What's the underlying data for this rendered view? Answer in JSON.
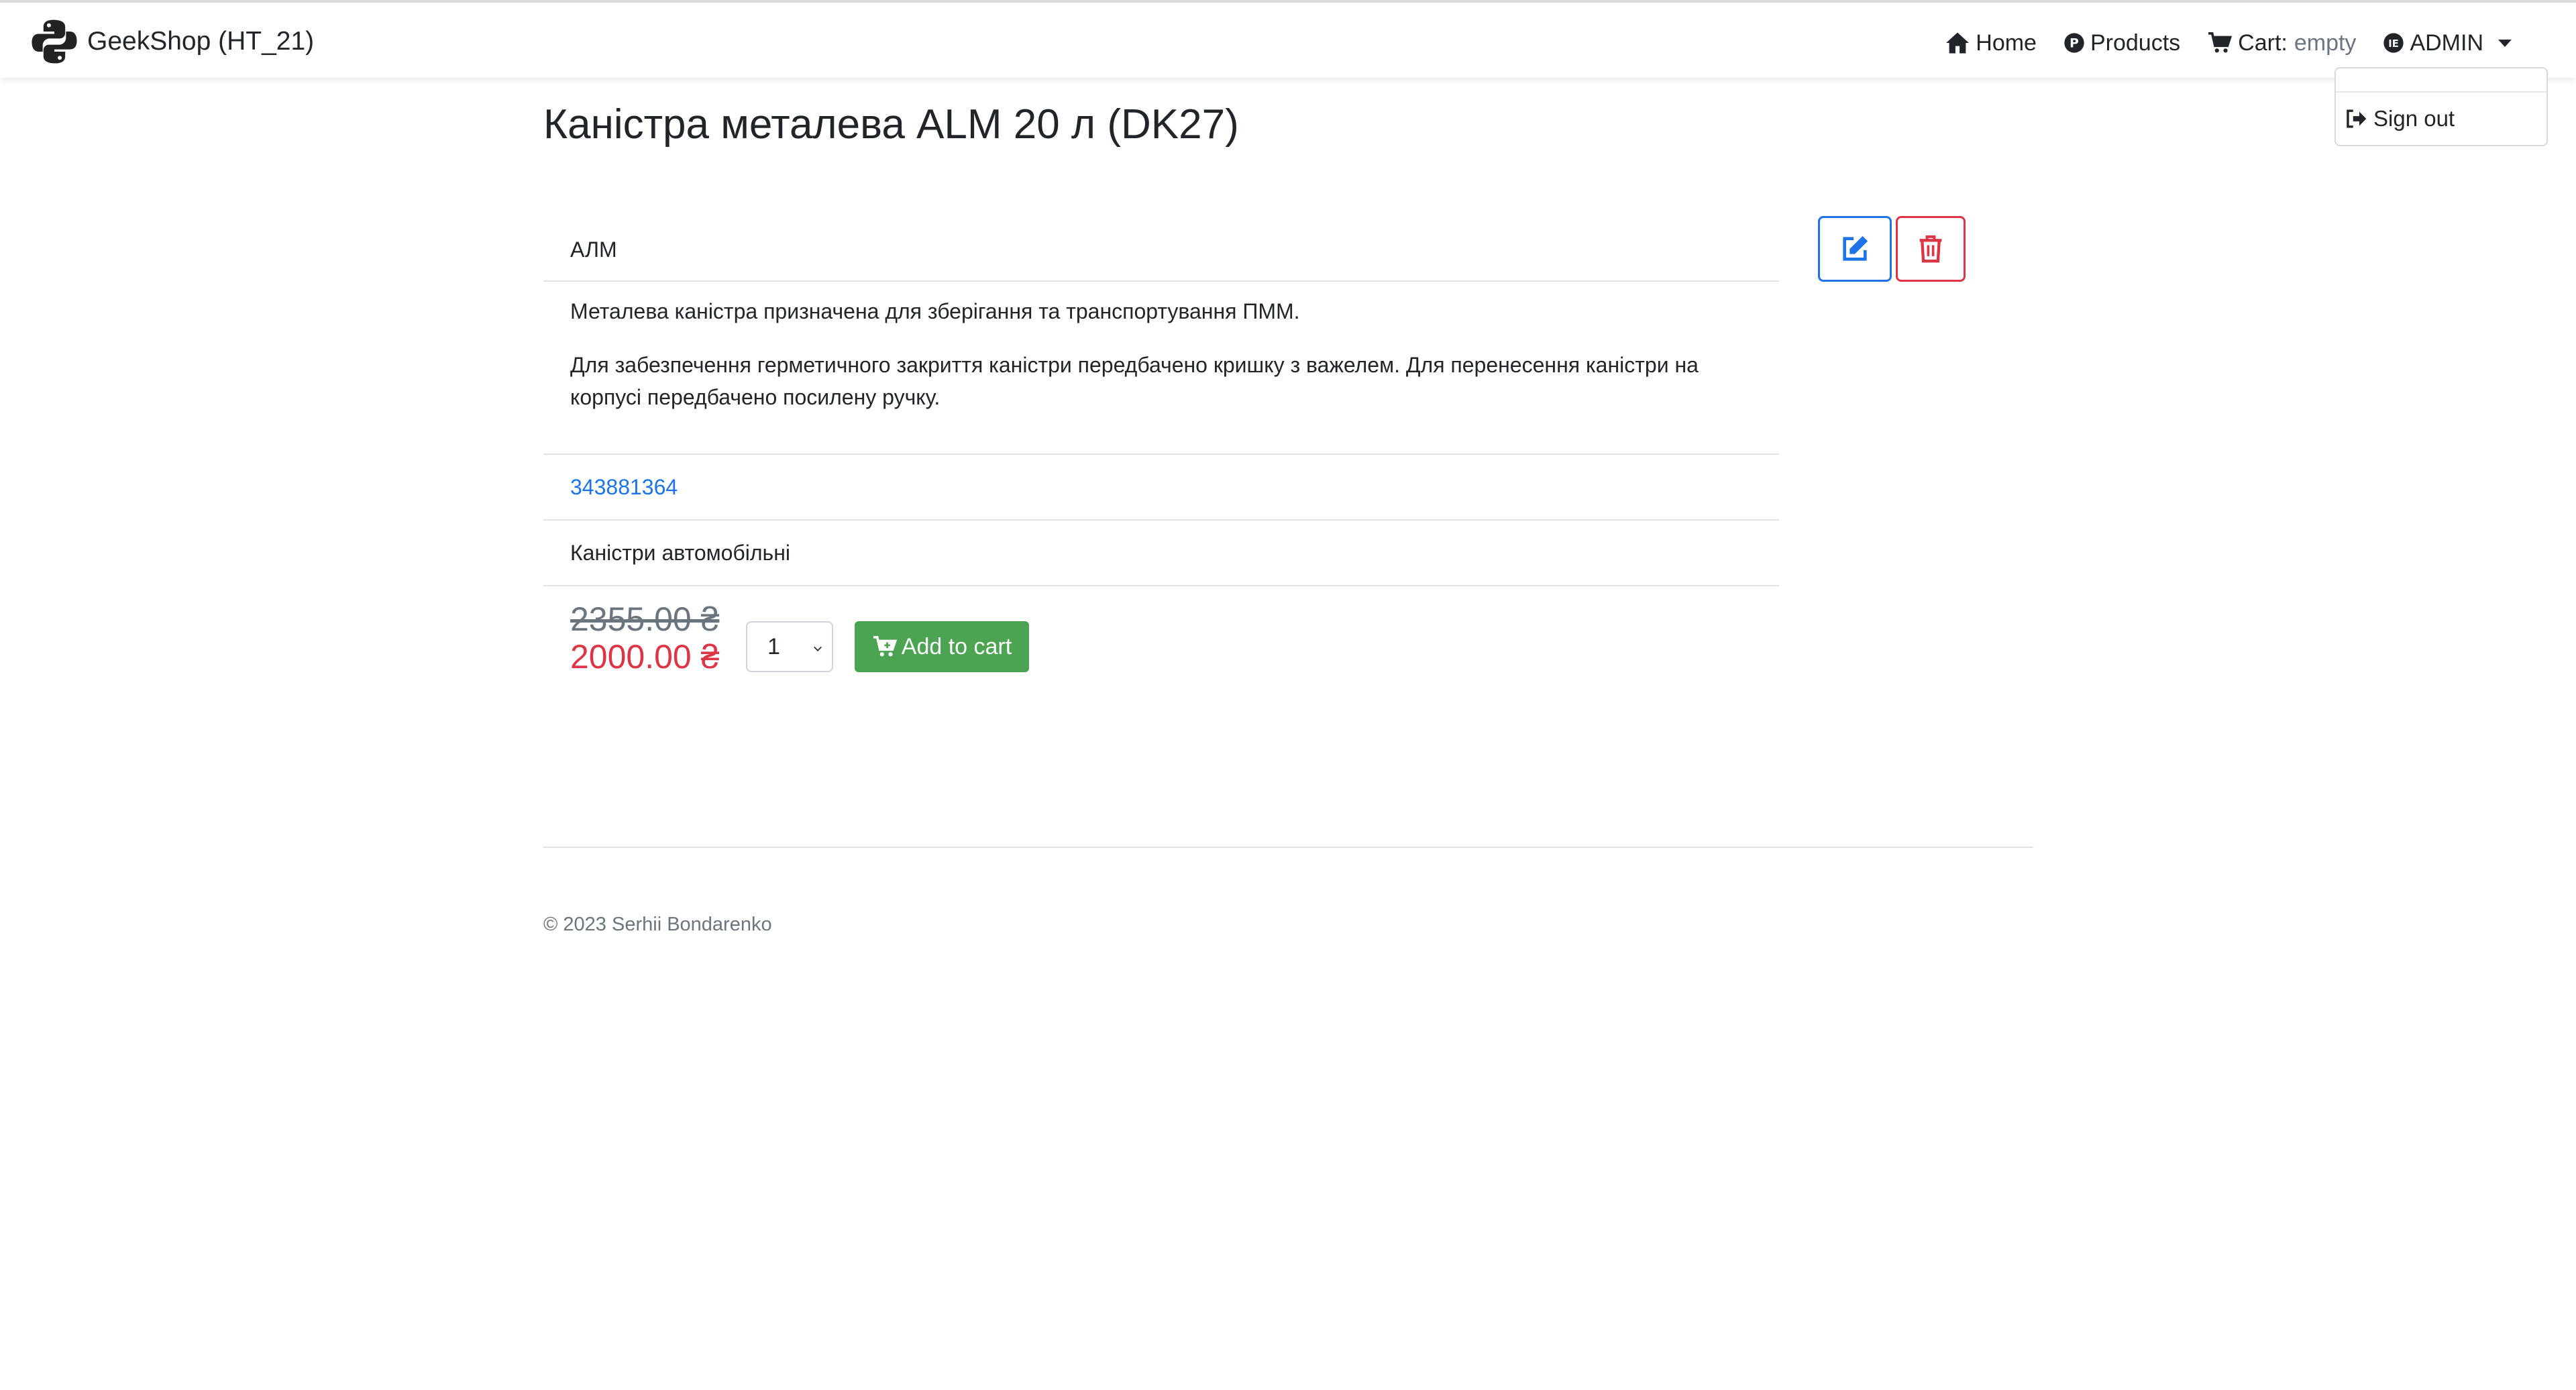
{
  "navbar": {
    "brand": "GeekShop (HT_21)",
    "home": "Home",
    "products": "Products",
    "cart_label": "Cart:",
    "cart_status": "empty",
    "user": "ADMIN"
  },
  "dropdown": {
    "sign_out": "Sign out"
  },
  "product": {
    "title": "Каністра металева ALM 20 л (DK27)",
    "brand": "АЛМ",
    "description_1": "Металева каністра призначена для зберігання та транспортування ПММ.",
    "description_2": "Для забезпечення герметичного закриття каністри передбачено кришку з важелем. Для перенесення каністри на корпусі передбачено посилену ручку.",
    "sku": "343881364",
    "category": "Каністри автомобільні",
    "old_price": "2355.00 ₴",
    "new_price": "2000.00 ₴",
    "quantity": "1",
    "add_to_cart": "Add to cart"
  },
  "footer": {
    "copyright": "© 2023 Serhii Bondarenko"
  },
  "colors": {
    "primary": "#1f73e8",
    "danger": "#dc3545",
    "success": "#4ca452",
    "muted": "#6c757d"
  }
}
